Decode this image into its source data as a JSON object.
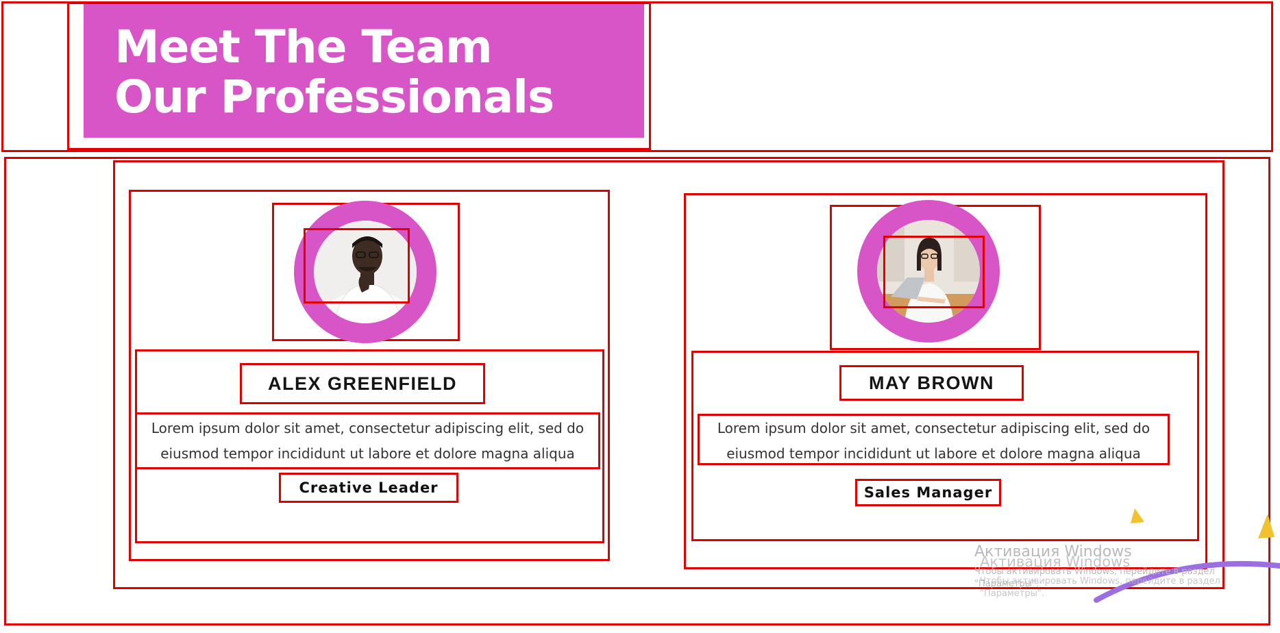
{
  "header": {
    "title_line1": "Meet The Team",
    "title_line2": "Our Professionals"
  },
  "team": [
    {
      "name": "ALEX GREENFIELD",
      "bio": "Lorem ipsum dolor sit amet, consectetur adipiscing elit, sed do eiusmod tempor incididunt ut labore et dolore magna aliqua",
      "role": "Creative Leader"
    },
    {
      "name": "MAY BROWN",
      "bio": "Lorem ipsum dolor sit amet, consectetur adipiscing elit, sed do eiusmod tempor incididunt ut labore et dolore magna aliqua",
      "role": "Sales Manager"
    }
  ],
  "watermark": {
    "title": "Активация Windows",
    "text": "Чтобы активировать Windows, перейдите в раздел \"Параметры\"."
  },
  "colors": {
    "accent": "#d755c6",
    "annotation_border": "#e00000",
    "decor_yellow": "#f2c12e",
    "decor_purple": "#9b6fe0"
  }
}
